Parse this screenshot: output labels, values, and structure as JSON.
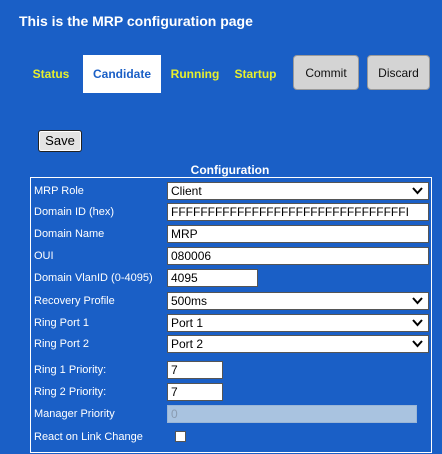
{
  "page": {
    "title": "This is the MRP configuration page"
  },
  "tabs": [
    {
      "label": "Status",
      "active": false
    },
    {
      "label": "Candidate",
      "active": true
    },
    {
      "label": "Running",
      "active": false
    },
    {
      "label": "Startup",
      "active": false
    }
  ],
  "actions": {
    "commit_label": "Commit",
    "discard_label": "Discard",
    "save_label": "Save"
  },
  "config": {
    "title": "Configuration",
    "mrp_role": {
      "label": "MRP Role",
      "value": "Client"
    },
    "domain_id": {
      "label": "Domain ID (hex)",
      "value": "FFFFFFFFFFFFFFFFFFFFFFFFFFFFFFFFI"
    },
    "domain_name": {
      "label": "Domain Name",
      "value": "MRP"
    },
    "oui": {
      "label": "OUI",
      "value": "080006"
    },
    "domain_vlan": {
      "label": "Domain VlanID (0-4095)",
      "value": "4095"
    },
    "recovery_profile": {
      "label": "Recovery Profile",
      "value": "500ms"
    },
    "ring_port_1": {
      "label": "Ring Port 1",
      "value": "Port 1"
    },
    "ring_port_2": {
      "label": "Ring Port 2",
      "value": "Port 2"
    },
    "ring_1_priority": {
      "label": "Ring 1 Priority:",
      "value": "7"
    },
    "ring_2_priority": {
      "label": "Ring 2 Priority:",
      "value": "7"
    },
    "manager_priority": {
      "label": "Manager Priority",
      "value": "0",
      "disabled": true
    },
    "react_on_link_change": {
      "label": "React on Link Change",
      "checked": false
    }
  },
  "colors": {
    "background": "#1a5fc6",
    "tab_link": "#e7ef2d",
    "active_tab_text": "#1a5fc6"
  }
}
